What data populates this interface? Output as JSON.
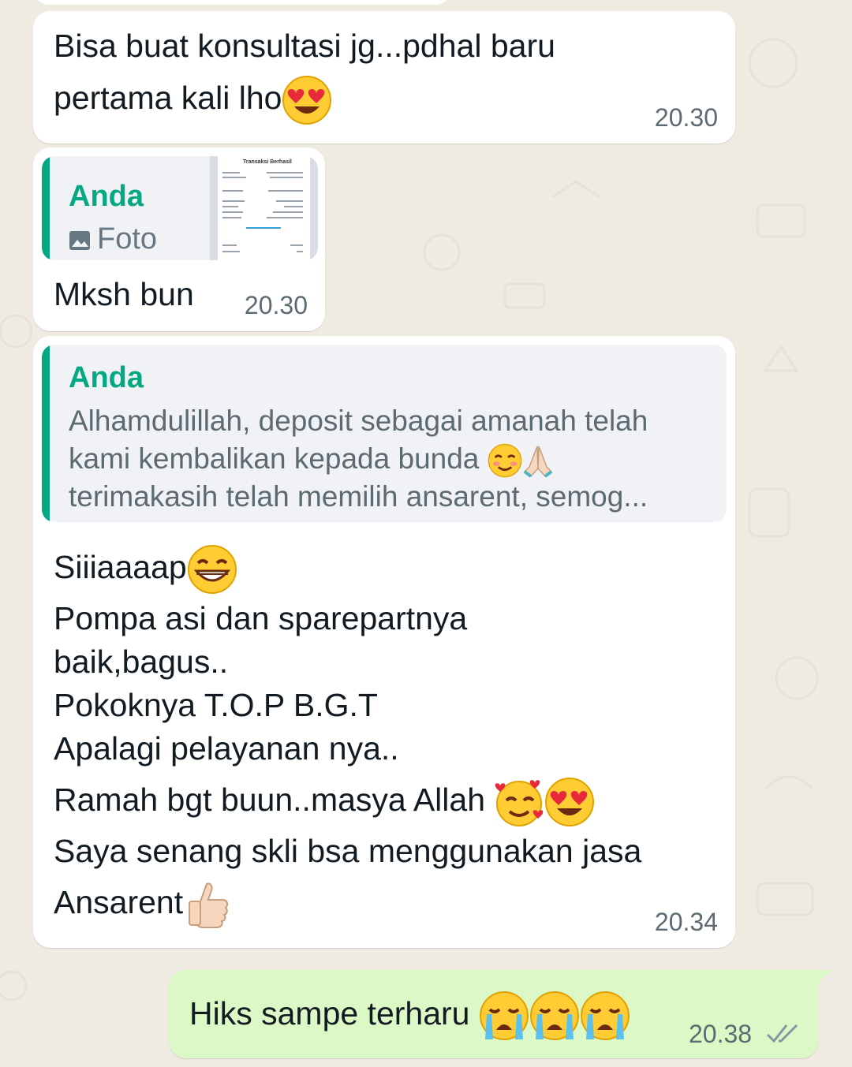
{
  "messages": [
    {
      "id": "m1",
      "direction": "incoming",
      "lines": [
        "Bisa buat konsultasi jg...pdhal baru",
        "pertama kali lho"
      ],
      "emojis": [
        "heart-eyes"
      ],
      "time": "20.30"
    },
    {
      "id": "m2",
      "direction": "incoming",
      "reply": {
        "name": "Anda",
        "label": "Foto",
        "icon": "photo-icon",
        "thumb_title": "Transaksi Berhasil"
      },
      "text": "Mksh bun",
      "time": "20.30"
    },
    {
      "id": "m3",
      "direction": "incoming",
      "reply": {
        "name": "Anda",
        "lines": [
          "Alhamdulillah, deposit sebagai amanah telah",
          "kami kembalikan kepada bunda",
          "terimakasih telah memilih ansarent, semog..."
        ]
      },
      "lines": [
        "Siiiaaaap",
        "Pompa asi dan sparepartnya",
        "baik,bagus..",
        "Pokoknya T.O.P B.G.T",
        "Apalagi pelayanan nya..",
        "Ramah bgt buun..masya Allah",
        "Saya senang skli bsa menggunakan jasa",
        "Ansarent"
      ],
      "time": "20.34"
    },
    {
      "id": "m4",
      "direction": "outgoing",
      "text": "Hiks sampe terharu",
      "emojis": [
        "crying",
        "crying",
        "crying"
      ],
      "time": "20.38",
      "status": "read"
    }
  ],
  "colors": {
    "background": "#efeae2",
    "incoming": "#ffffff",
    "outgoing": "#dcf8c6",
    "accent": "#06a884"
  }
}
